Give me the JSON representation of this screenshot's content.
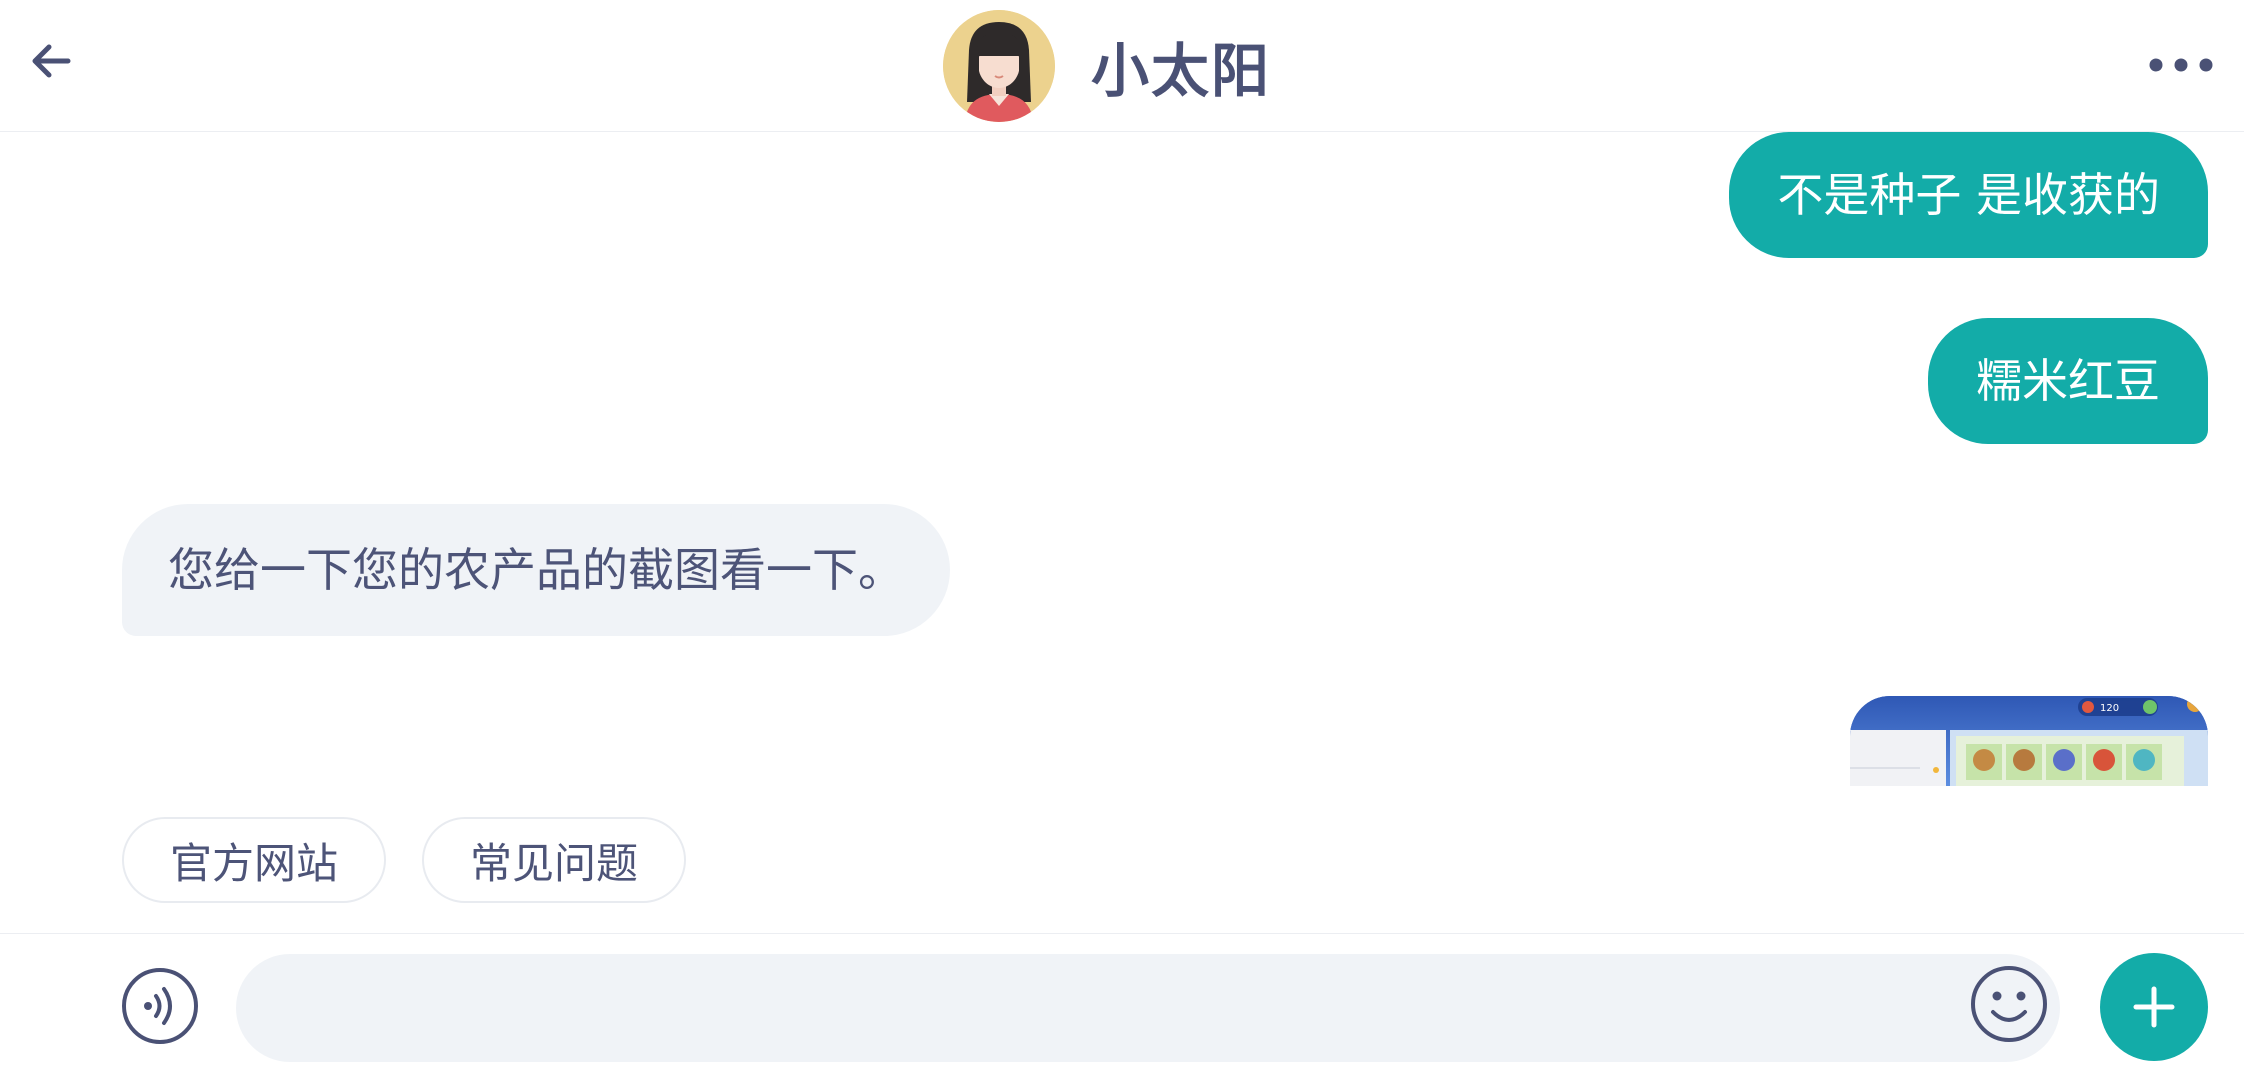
{
  "header": {
    "back_icon": "arrow-left-icon",
    "contact_name": "小太阳",
    "more_icon": "more-horizontal-icon"
  },
  "messages": [
    {
      "direction": "outgoing",
      "type": "text",
      "text": "不是种子 是收获的"
    },
    {
      "direction": "outgoing",
      "type": "text",
      "text": "糯米红豆"
    },
    {
      "direction": "incoming",
      "type": "text",
      "text": "您给一下您的农产品的截图看一下。"
    },
    {
      "direction": "outgoing",
      "type": "image",
      "image_badge": "120"
    }
  ],
  "quick_replies": [
    {
      "label": "官方网站"
    },
    {
      "label": "常见问题"
    }
  ],
  "input_bar": {
    "voice_icon": "voice-icon",
    "input_value": "",
    "input_placeholder": "",
    "emoji_icon": "emoji-icon",
    "plus_icon": "plus-icon"
  },
  "colors": {
    "accent": "#13aca8",
    "text_dark": "#4a5175",
    "bubble_incoming": "#f0f3f7"
  }
}
